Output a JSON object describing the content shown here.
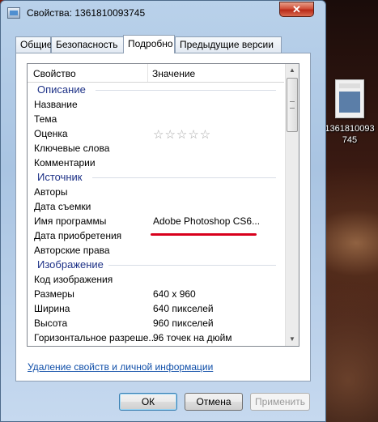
{
  "window": {
    "title": "Свойства: 1361810093745",
    "close_label": "✕"
  },
  "tabs": [
    {
      "label": "Общие"
    },
    {
      "label": "Безопасность"
    },
    {
      "label": "Подробно"
    },
    {
      "label": "Предыдущие версии"
    }
  ],
  "list": {
    "col_property": "Свойство",
    "col_value": "Значение",
    "groups": {
      "description": {
        "title": "Описание",
        "rows": [
          {
            "name": "Название",
            "value": ""
          },
          {
            "name": "Тема",
            "value": ""
          },
          {
            "name": "Оценка",
            "value": ""
          },
          {
            "name": "Ключевые слова",
            "value": ""
          },
          {
            "name": "Комментарии",
            "value": ""
          }
        ]
      },
      "source": {
        "title": "Источник",
        "rows": [
          {
            "name": "Авторы",
            "value": ""
          },
          {
            "name": "Дата съемки",
            "value": ""
          },
          {
            "name": "Имя программы",
            "value": "Adobe Photoshop CS6..."
          },
          {
            "name": "Дата приобретения",
            "value": ""
          },
          {
            "name": "Авторские права",
            "value": ""
          }
        ]
      },
      "image": {
        "title": "Изображение",
        "rows": [
          {
            "name": "Код изображения",
            "value": ""
          },
          {
            "name": "Размеры",
            "value": "640 x 960"
          },
          {
            "name": "Ширина",
            "value": "640 пикселей"
          },
          {
            "name": "Высота",
            "value": "960 пикселей"
          },
          {
            "name": "Горизонтальное разреше...",
            "value": "96 точек на дюйм"
          }
        ]
      }
    },
    "rating_stars": "☆☆☆☆☆",
    "rating_value": 0
  },
  "link_remove": "Удаление свойств и личной информации",
  "buttons": {
    "ok": "ОК",
    "cancel": "Отмена",
    "apply": "Применить"
  },
  "desktop": {
    "icon_label": "1361810093745",
    "icon_name": "image-file-icon"
  },
  "colors": {
    "group_title": "#1e3287",
    "link": "#0f4ea8",
    "highlight_underline": "#d8001c"
  }
}
